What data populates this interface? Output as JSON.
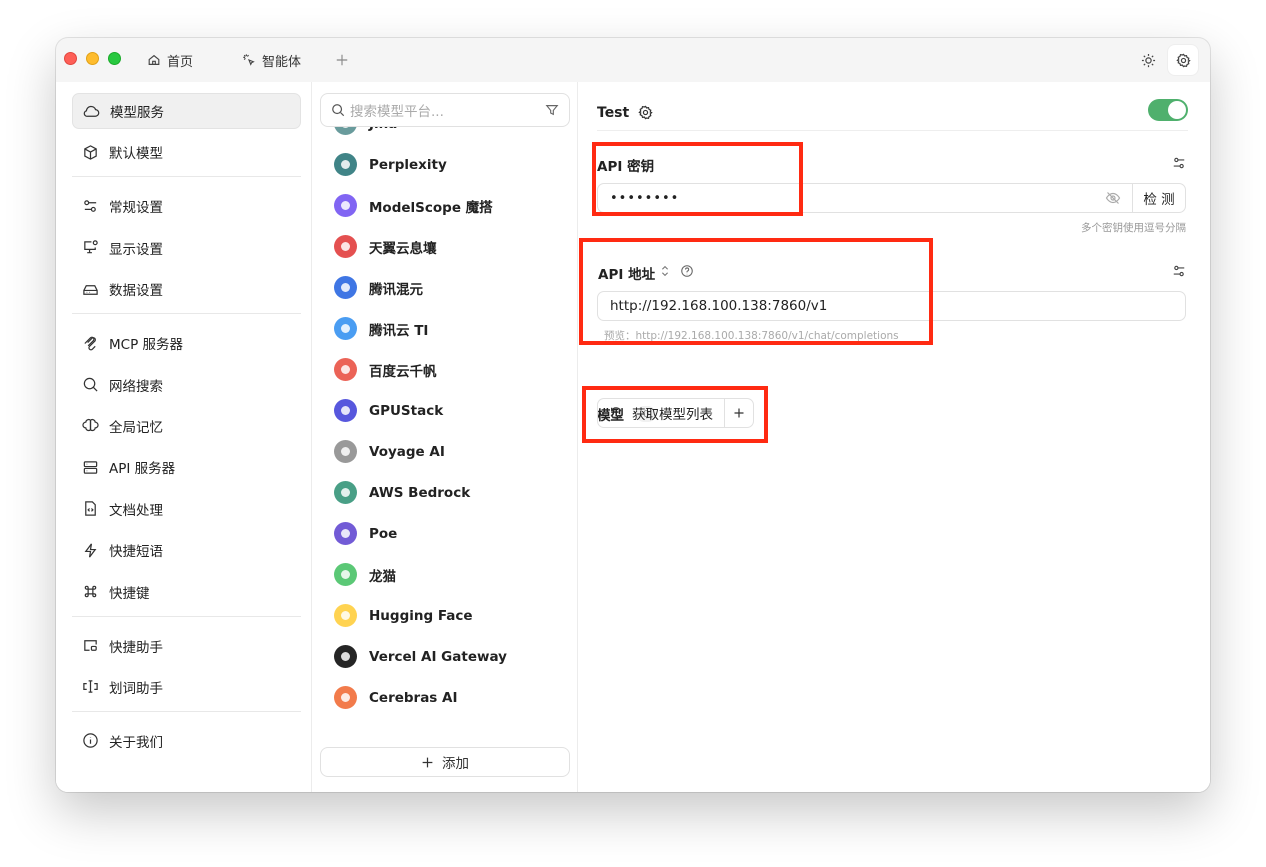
{
  "tabs": [
    {
      "label": "首页",
      "icon": "home-icon"
    },
    {
      "label": "智能体",
      "icon": "sparkle-pointer-icon"
    }
  ],
  "titlebar": {
    "add_tab_icon": "plus-icon",
    "theme_icon": "sun-icon",
    "settings_icon": "gear-icon"
  },
  "nav": {
    "items": [
      {
        "label": "模型服务",
        "icon": "cloud-icon",
        "active": true
      },
      {
        "label": "默认模型",
        "icon": "cube-icon"
      },
      {
        "label": "常规设置",
        "icon": "sliders-icon"
      },
      {
        "label": "显示设置",
        "icon": "monitor-gear-icon"
      },
      {
        "label": "数据设置",
        "icon": "hard-drive-icon"
      },
      {
        "label": "MCP 服务器",
        "icon": "mcp-icon"
      },
      {
        "label": "网络搜索",
        "icon": "search-icon"
      },
      {
        "label": "全局记忆",
        "icon": "brain-icon"
      },
      {
        "label": "API 服务器",
        "icon": "server-icon"
      },
      {
        "label": "文档处理",
        "icon": "file-code-icon"
      },
      {
        "label": "快捷短语",
        "icon": "lightning-icon"
      },
      {
        "label": "快捷键",
        "icon": "command-icon"
      },
      {
        "label": "快捷助手",
        "icon": "window-assistant-icon"
      },
      {
        "label": "划词助手",
        "icon": "text-cursor-icon"
      },
      {
        "label": "关于我们",
        "icon": "info-icon"
      }
    ]
  },
  "providers": {
    "search_placeholder": "搜索模型平台...",
    "list": [
      {
        "name": "Jina",
        "color": "#4f8a8b"
      },
      {
        "name": "Perplexity",
        "color": "#1f6f73"
      },
      {
        "name": "ModelScope 魔搭",
        "color": "#6c4bf2"
      },
      {
        "name": "天翼云息壤",
        "color": "#e03232"
      },
      {
        "name": "腾讯混元",
        "color": "#1e5fe0"
      },
      {
        "name": "腾讯云 TI",
        "color": "#2b8cf0"
      },
      {
        "name": "百度云千帆",
        "color": "#e8483a"
      },
      {
        "name": "GPUStack",
        "color": "#3a3ad8"
      },
      {
        "name": "Voyage AI",
        "color": "#888888"
      },
      {
        "name": "AWS Bedrock",
        "color": "#2a8f72"
      },
      {
        "name": "Poe",
        "color": "#5a3fd0"
      },
      {
        "name": "龙猫",
        "color": "#3fbf5f"
      },
      {
        "name": "Hugging Face",
        "color": "#ffcc33"
      },
      {
        "name": "Vercel AI Gateway",
        "color": "#000000"
      },
      {
        "name": "Cerebras AI",
        "color": "#f0642c"
      }
    ],
    "add_label": "添加"
  },
  "settings": {
    "title": "Test",
    "enabled": true,
    "api_key": {
      "label": "API 密钥",
      "value": "••••••••",
      "check_label": "检 测",
      "hint": "多个密钥使用逗号分隔"
    },
    "api_url": {
      "label": "API 地址",
      "value": "http://192.168.100.138:7860/v1",
      "preview": "预览：http://192.168.100.138:7860/v1/chat/completions"
    },
    "models": {
      "label": "模型",
      "count": "0",
      "fetch_label": "获取模型列表"
    }
  },
  "colors": {
    "toggle_on": "#4fb06d",
    "highlight": "#ff2a12"
  }
}
